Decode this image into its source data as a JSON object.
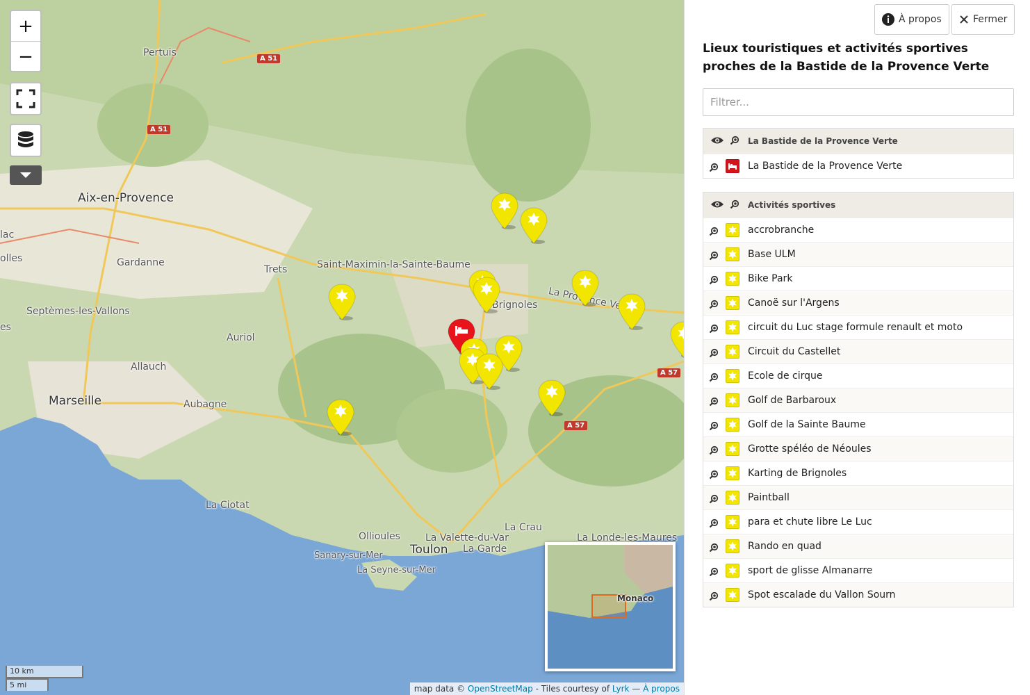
{
  "map": {
    "zoom_in": "+",
    "zoom_out": "−",
    "labels": {
      "pertuis": "Pertuis",
      "aix": "Aix-en-Provence",
      "gardanne": "Gardanne",
      "trets": "Trets",
      "saint_max": "Saint-Maximin-la-Sainte-Baume",
      "septemes": "Septèmes-les-Vallons",
      "auriol": "Auriol",
      "allauch": "Allauch",
      "marseille": "Marseille",
      "aubagne": "Aubagne",
      "brignoles": "Brignoles",
      "provence_verte": "La Provence Verte",
      "la_ciotat": "La Ciotat",
      "ollioules": "Ollioules",
      "toulon": "Toulon",
      "valette": "La Valette-du-Var",
      "la_garde": "La Garde",
      "la_crau": "La Crau",
      "londe": "La Londe-les-Maures",
      "sanary": "Sanary-sur-Mer",
      "seyne": "La Seyne-sur-Mer",
      "monaco": "Monaco",
      "lac": "lac",
      "olles": "olles",
      "es": "es"
    },
    "roads": {
      "a51_top": "A 51",
      "a51_left": "A 51",
      "a57_right": "A 57",
      "a57_bottom": "A 57"
    },
    "scale": {
      "km": "10 km",
      "mi": "5 mi"
    },
    "attribution": {
      "prefix": "map data © ",
      "osm": "OpenStreetMap",
      "mid": " - Tiles courtesy of ",
      "lyrk": "Lyrk",
      "sep": " — ",
      "about": "À propos"
    },
    "colors": {
      "marker_sport": "#f2e600",
      "marker_hotel": "#e8141c"
    }
  },
  "panel": {
    "about_label": "À propos",
    "close_label": "Fermer",
    "title": "Lieux touristiques et activités sportives proches de la Bastide de la Provence Verte",
    "filter_placeholder": "Filtrer...",
    "groups": [
      {
        "name": "La Bastide de la Provence Verte",
        "icon": "bed-icon",
        "color": "#d3141c",
        "items": [
          "La Bastide de la Provence Verte"
        ]
      },
      {
        "name": "Activités sportives",
        "icon": "star-icon",
        "color": "#f2e600",
        "items": [
          "accrobranche",
          "Base ULM",
          "Bike Park",
          "Canoë sur l'Argens",
          "circuit du Luc stage formule renault et moto",
          "Circuit du Castellet",
          "Ecole de cirque",
          "Golf de Barbaroux",
          "Golf de la Sainte Baume",
          "Grotte spéléo de Néoules",
          "Karting de Brignoles",
          "Paintball",
          "para et chute libre Le Luc",
          "Rando en quad",
          "sport de glisse Almanarre",
          "Spot escalade du Vallon Sourn"
        ]
      }
    ]
  }
}
